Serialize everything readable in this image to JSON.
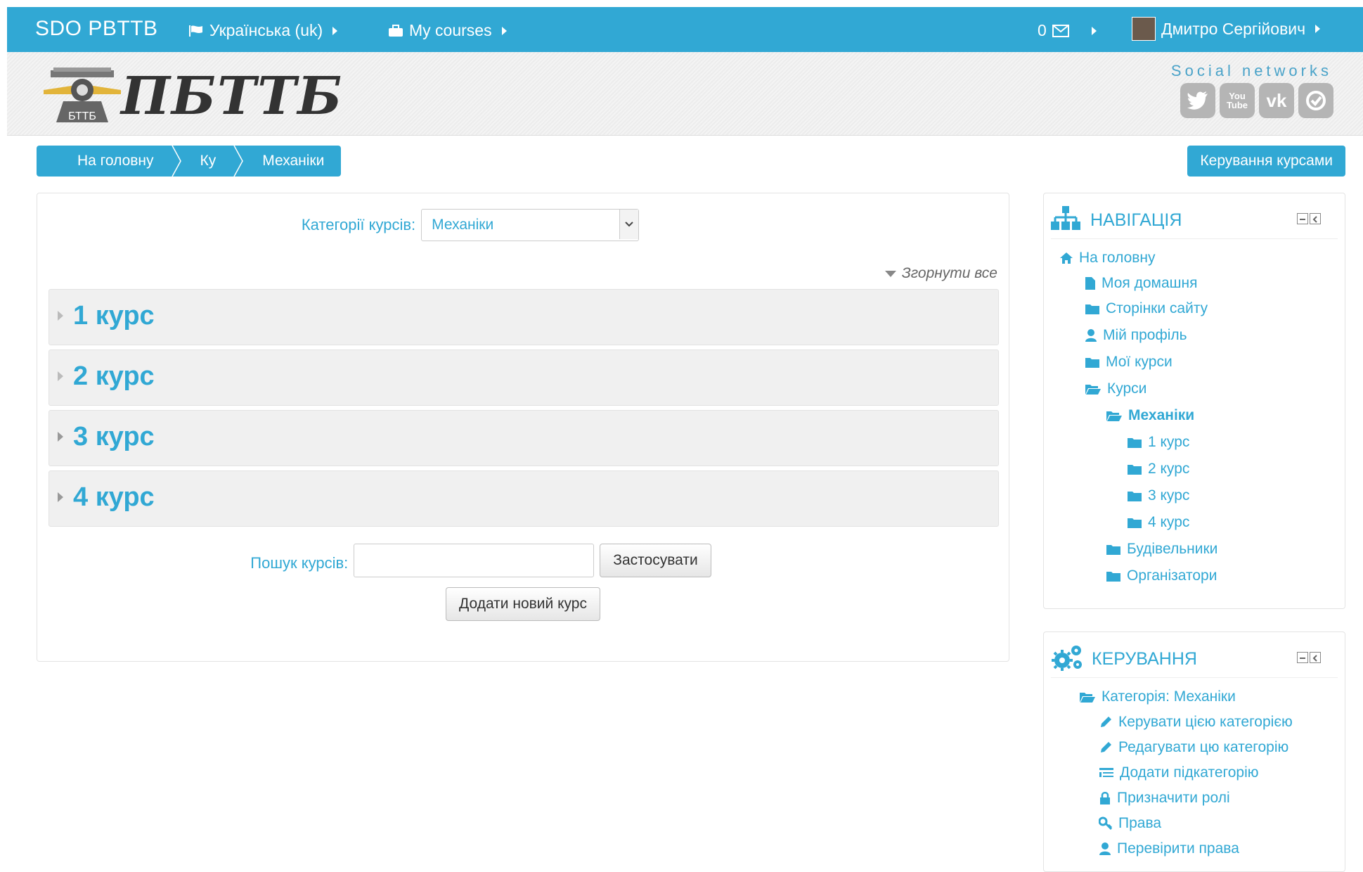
{
  "topbar": {
    "brand": "SDO PBTTB",
    "language": "Українська (uk)",
    "my_courses": "My courses",
    "messages_count": "0",
    "user_name": "Дмитро Сергійович"
  },
  "header": {
    "logo_text": "ПБТТБ",
    "emblem_text": "БТТБ",
    "social_label": "Social networks",
    "social_icons": [
      "twitter-icon",
      "youtube-icon",
      "vk-icon",
      "web-icon"
    ],
    "youtube_text": "You Tube",
    "vk_text": "vk"
  },
  "breadcrumb": [
    "На головну",
    "Ку",
    "Механіки"
  ],
  "manage_courses_button": "Керування курсами",
  "main": {
    "category_label": "Категорії курсів:",
    "category_value": "Механіки",
    "collapse_all": "Згорнути все",
    "courses": [
      "1 курс",
      "2 курс",
      "3 курс",
      "4 курс"
    ],
    "search_label": "Пошук курсів:",
    "search_placeholder": "",
    "apply_button": "Застосувати",
    "add_course_button": "Додати новий курс"
  },
  "navigation": {
    "title": "НАВІГАЦІЯ",
    "items": [
      {
        "label": "На головну",
        "icon": "home-icon"
      },
      {
        "label": "Моя домашня",
        "icon": "file-icon"
      },
      {
        "label": "Сторінки сайту",
        "icon": "folder-icon"
      },
      {
        "label": "Мій профіль",
        "icon": "user-icon"
      },
      {
        "label": "Мої курси",
        "icon": "folder-icon"
      },
      {
        "label": "Курси",
        "icon": "folder-open-icon"
      },
      {
        "label": "Механіки",
        "icon": "folder-open-icon"
      },
      {
        "label": "1 курс",
        "icon": "folder-icon"
      },
      {
        "label": "2 курс",
        "icon": "folder-icon"
      },
      {
        "label": "3 курс",
        "icon": "folder-icon"
      },
      {
        "label": "4 курс",
        "icon": "folder-icon"
      },
      {
        "label": "Будівельники",
        "icon": "folder-icon"
      },
      {
        "label": "Організатори",
        "icon": "folder-icon"
      }
    ]
  },
  "administration": {
    "title": "КЕРУВАННЯ",
    "items": [
      {
        "label": "Категорія: Механіки",
        "icon": "folder-open-icon"
      },
      {
        "label": "Керувати цією категорією",
        "icon": "pencil-icon"
      },
      {
        "label": "Редагувати цю категорію",
        "icon": "pencil-icon"
      },
      {
        "label": "Додати підкатегорію",
        "icon": "list-icon"
      },
      {
        "label": "Призначити ролі",
        "icon": "lock-icon"
      },
      {
        "label": "Права",
        "icon": "key-icon"
      },
      {
        "label": "Перевірити права",
        "icon": "user-icon"
      }
    ]
  },
  "colors": {
    "accent": "#31a8d4",
    "text": "#333333"
  }
}
